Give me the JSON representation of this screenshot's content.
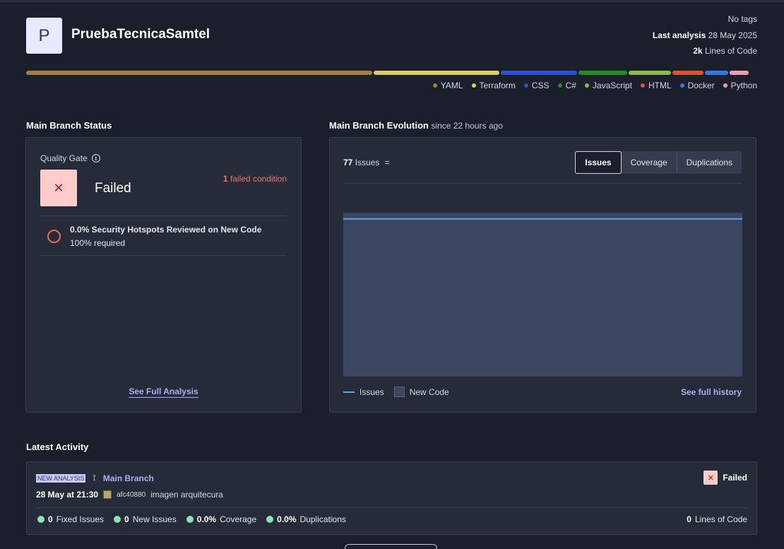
{
  "project": {
    "avatar_letter": "P",
    "name": "PruebaTecnicaSamtel",
    "tags": "No tags",
    "last_analysis_label": "Last analysis",
    "last_analysis_date": "28 May 2025",
    "loc_value": "2k",
    "loc_label": "Lines of Code"
  },
  "languages": [
    {
      "name": "YAML",
      "color": "#a57f3b",
      "share": 0.48
    },
    {
      "name": "Terraform",
      "color": "#d8cc63",
      "share": 0.174
    },
    {
      "name": "CSS",
      "color": "#2b4fd8",
      "share": 0.106
    },
    {
      "name": "C#",
      "color": "#1f8f1f",
      "share": 0.068
    },
    {
      "name": "JavaScript",
      "color": "#8dbb4a",
      "share": 0.058
    },
    {
      "name": "HTML",
      "color": "#e0522b",
      "share": 0.044
    },
    {
      "name": "Docker",
      "color": "#2d7be0",
      "share": 0.032
    },
    {
      "name": "Python",
      "color": "#f09bb6",
      "share": 0.026
    }
  ],
  "status": {
    "section_title": "Main Branch Status",
    "quality_gate_label": "Quality Gate",
    "result": "Failed",
    "failed_count": "1",
    "failed_text": "failed condition",
    "condition_title": "0.0% Security Hotspots Reviewed on New Code",
    "condition_sub": "100% required",
    "see_full_analysis": "See Full Analysis"
  },
  "evolution": {
    "section_title": "Main Branch Evolution",
    "since": "since 22 hours ago",
    "issues_count": "77",
    "issues_label": "Issues",
    "issues_suffix": "=",
    "tabs": [
      {
        "label": "Issues",
        "active": true
      },
      {
        "label": "Coverage",
        "active": false
      },
      {
        "label": "Duplications",
        "active": false
      }
    ],
    "legend_issues": "Issues",
    "legend_new_code": "New Code",
    "see_full_history": "See full history",
    "series_color": "#5ba8e6",
    "new_code_color": "#3b4660"
  },
  "chart_data": {
    "type": "line",
    "series": [
      {
        "name": "Issues",
        "values": [
          77,
          77
        ]
      }
    ],
    "new_code_period": true,
    "ylim": [
      0,
      80
    ],
    "grid": false,
    "legend": "bottom-left"
  },
  "activity": {
    "section_title": "Latest Activity",
    "badge": "NEW ANALYSIS",
    "branch": "Main Branch",
    "status": "Failed",
    "datetime": "28 May at 21:30",
    "commit": "afc40880",
    "commit_message": "imagen arquitecura",
    "stats": [
      {
        "value": "0",
        "label": "Fixed Issues"
      },
      {
        "value": "0",
        "label": "New Issues"
      },
      {
        "value": "0.0%",
        "label": "Coverage"
      },
      {
        "value": "0.0%",
        "label": "Duplications"
      }
    ],
    "loc_value": "0",
    "loc_label": "Lines of Code"
  }
}
